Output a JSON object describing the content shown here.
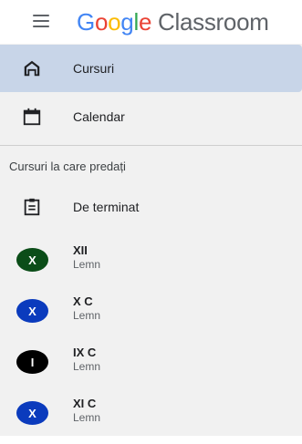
{
  "header": {
    "logo_parts": [
      "G",
      "o",
      "o",
      "g",
      "l",
      "e"
    ],
    "product": "Classroom"
  },
  "nav": {
    "courses_label": "Cursuri",
    "calendar_label": "Calendar",
    "section_title": "Cursuri la care predați",
    "todo_label": "De terminat"
  },
  "courses": [
    {
      "initial": "X",
      "name": "XII",
      "section": "Lemn",
      "color": "#0b4d18"
    },
    {
      "initial": "X",
      "name": "X C",
      "section": "Lemn",
      "color": "#0b3bbd"
    },
    {
      "initial": "I",
      "name": "IX C",
      "section": "Lemn",
      "color": "#000000"
    },
    {
      "initial": "X",
      "name": "XI C",
      "section": "Lemn",
      "color": "#0b3bbd"
    }
  ],
  "colors": {
    "active_bg": "#c8d5e8",
    "nav_bg": "#f1f1f1"
  }
}
